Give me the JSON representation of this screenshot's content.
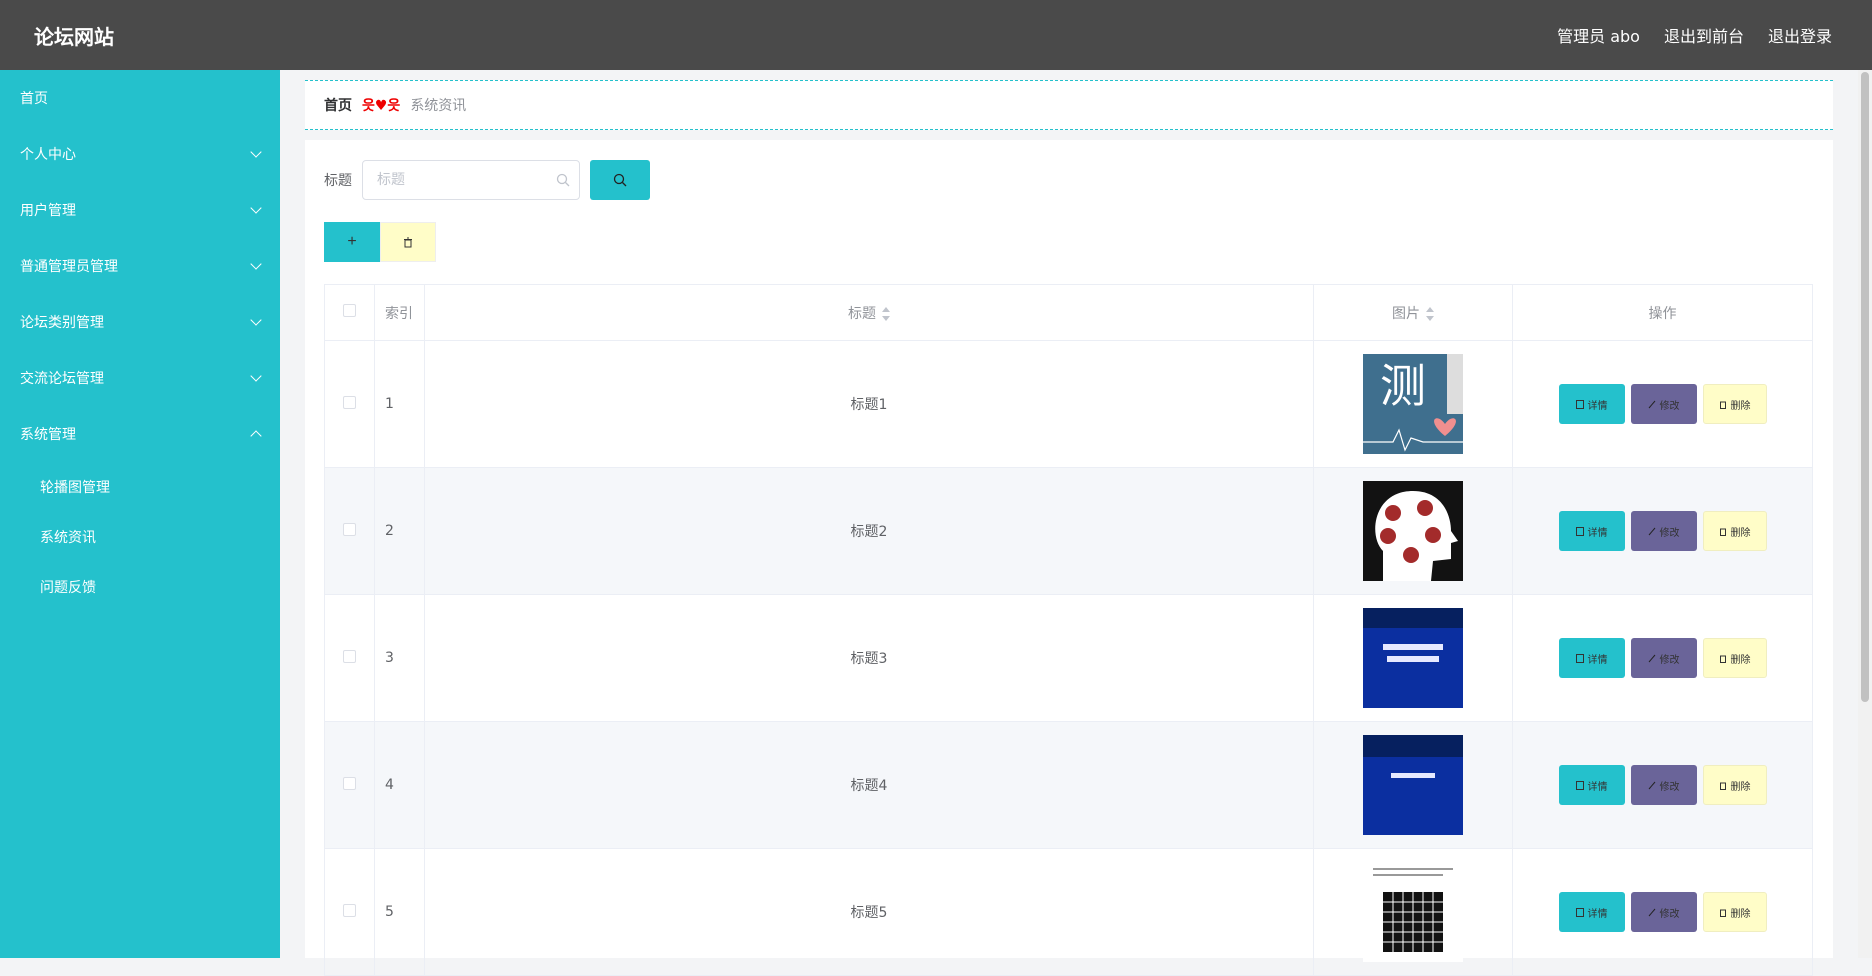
{
  "app": {
    "title": "论坛网站"
  },
  "topnav": {
    "user": "管理员 abo",
    "front": "退出到前台",
    "logout": "退出登录"
  },
  "sidebar": {
    "items": [
      {
        "label": "首页",
        "expandable": false
      },
      {
        "label": "个人中心",
        "expandable": true
      },
      {
        "label": "用户管理",
        "expandable": true
      },
      {
        "label": "普通管理员管理",
        "expandable": true
      },
      {
        "label": "论坛类别管理",
        "expandable": true
      },
      {
        "label": "交流论坛管理",
        "expandable": true
      },
      {
        "label": "系统管理",
        "expandable": true,
        "expanded": true
      }
    ],
    "subitems": [
      "轮播图管理",
      "系统资讯",
      "问题反馈"
    ]
  },
  "breadcrumb": {
    "home": "首页",
    "sep": "읏♥읏",
    "current": "系统资讯"
  },
  "search": {
    "label": "标题",
    "placeholder": "标题"
  },
  "toolbar": {
    "add": "+"
  },
  "table": {
    "headers": {
      "index": "索引",
      "title": "标题",
      "image": "图片",
      "ops": "操作"
    },
    "ops": {
      "detail": "详情",
      "edit": "修改",
      "delete": "删除"
    },
    "rows": [
      {
        "index": "1",
        "title": "标题1",
        "image": "测 (test heartbeat image)"
      },
      {
        "index": "2",
        "title": "标题2",
        "image": "心理测试 head image"
      },
      {
        "index": "3",
        "title": "标题3",
        "image": "症状自评量表 (SCL—90问卷)"
      },
      {
        "index": "4",
        "title": "标题4",
        "image": "应对方式问卷"
      },
      {
        "index": "5",
        "title": "标题5",
        "image": "grid puzzle image"
      }
    ]
  },
  "colors": {
    "accent": "#24c1cc",
    "topbar": "#4a4a4a",
    "edit": "#6a6499",
    "delete": "#fffdc8"
  }
}
